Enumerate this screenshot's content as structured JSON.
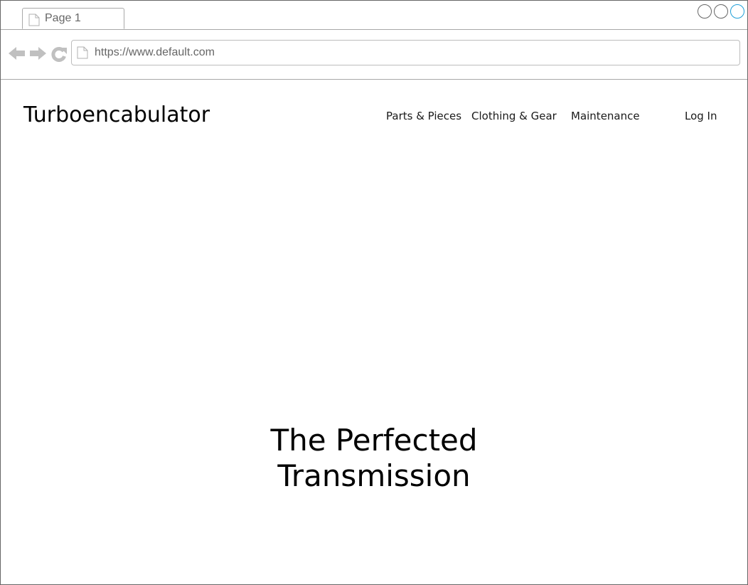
{
  "browser": {
    "tab_title": "Page 1",
    "url": "https://www.default.com",
    "controls": [
      "minimize-icon",
      "maximize-icon",
      "close-icon"
    ],
    "nav_icons": [
      "back-arrow-icon",
      "forward-arrow-icon",
      "reload-icon"
    ]
  },
  "site": {
    "title": "Turboencabulator",
    "nav": {
      "parts": "Parts & Pieces",
      "clothing": "Clothing & Gear",
      "maintenance": "Maintenance",
      "login": "Log In"
    },
    "hero": {
      "line1": "The Perfected",
      "line2": "Transmission"
    }
  },
  "colors": {
    "close_button": "#1f9fd8",
    "chrome_icon": "#c0c0c0",
    "border": "#a8a8a8"
  }
}
